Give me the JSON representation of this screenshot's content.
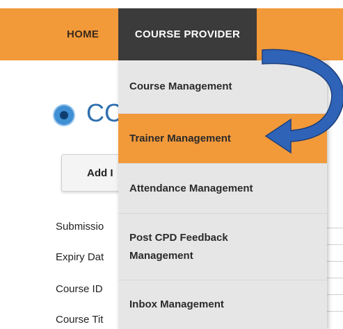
{
  "nav": {
    "home_label": "HOME",
    "provider_label": "COURSE PROVIDER"
  },
  "page": {
    "heading": "CC",
    "add_button_label": "Add I",
    "fields": [
      "Submissio",
      "Expiry Dat",
      "Course ID",
      "Course Tit"
    ]
  },
  "dropdown": {
    "items": [
      {
        "label": "Course Management",
        "active": false
      },
      {
        "label": "Trainer Management",
        "active": true
      },
      {
        "label": "Attendance Management",
        "active": false
      },
      {
        "label": "Post CPD Feedback Management",
        "active": false
      },
      {
        "label": "Inbox Management",
        "active": false
      }
    ]
  },
  "colors": {
    "nav_bg": "#f2993a",
    "nav_active_bg": "#3b3b3b",
    "menu_bg": "#e6e6e6",
    "menu_active_bg": "#f2993a",
    "arrow_fill": "#2f63b8",
    "heading_color": "#2f6fae"
  },
  "icons": {
    "heading_icon": "radio-dot-icon",
    "annotation_arrow": "curved-arrow-icon"
  }
}
